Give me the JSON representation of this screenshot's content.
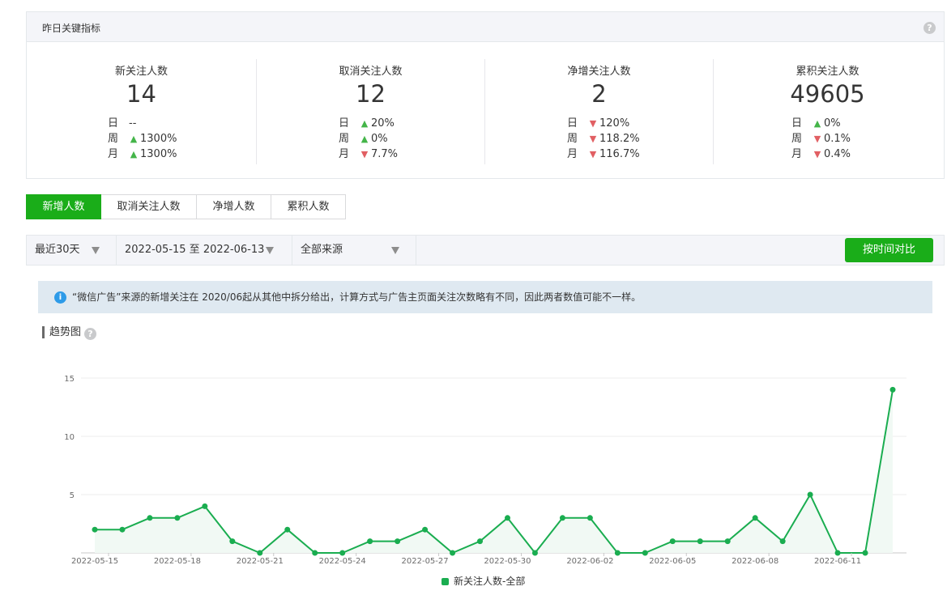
{
  "metrics_panel": {
    "title": "昨日关键指标",
    "help": "?",
    "cards": [
      {
        "label": "新关注人数",
        "value": "14",
        "rows": [
          {
            "key": "日",
            "dir": "none",
            "val": "--"
          },
          {
            "key": "周",
            "dir": "up",
            "val": "1300%"
          },
          {
            "key": "月",
            "dir": "up",
            "val": "1300%"
          }
        ]
      },
      {
        "label": "取消关注人数",
        "value": "12",
        "rows": [
          {
            "key": "日",
            "dir": "up",
            "val": "20%"
          },
          {
            "key": "周",
            "dir": "up",
            "val": "0%"
          },
          {
            "key": "月",
            "dir": "down",
            "val": "7.7%"
          }
        ]
      },
      {
        "label": "净增关注人数",
        "value": "2",
        "rows": [
          {
            "key": "日",
            "dir": "down",
            "val": "120%"
          },
          {
            "key": "周",
            "dir": "down",
            "val": "118.2%"
          },
          {
            "key": "月",
            "dir": "down",
            "val": "116.7%"
          }
        ]
      },
      {
        "label": "累积关注人数",
        "value": "49605",
        "rows": [
          {
            "key": "日",
            "dir": "up",
            "val": "0%"
          },
          {
            "key": "周",
            "dir": "down",
            "val": "0.1%"
          },
          {
            "key": "月",
            "dir": "down",
            "val": "0.4%"
          }
        ]
      }
    ]
  },
  "tabs": [
    {
      "label": "新增人数",
      "active": true
    },
    {
      "label": "取消关注人数",
      "active": false
    },
    {
      "label": "净增人数",
      "active": false
    },
    {
      "label": "累积人数",
      "active": false
    }
  ],
  "filters": {
    "period": "最近30天",
    "date_range": "2022-05-15 至 2022-06-13",
    "source": "全部来源",
    "compare_button": "按时间对比"
  },
  "notice": {
    "icon": "i",
    "text": "“微信广告”来源的新增关注在 2020/06起从其他中拆分给出，计算方式与广告主页面关注次数略有不同，因此两者数值可能不一样。"
  },
  "trend": {
    "title": "趋势图",
    "help": "?"
  },
  "colors": {
    "accent": "#1aad19",
    "line": "#1aad50",
    "up": "#44b549",
    "down": "#e15f63"
  },
  "chart_data": {
    "type": "line",
    "x": [
      "2022-05-15",
      "2022-05-16",
      "2022-05-17",
      "2022-05-18",
      "2022-05-19",
      "2022-05-20",
      "2022-05-21",
      "2022-05-22",
      "2022-05-23",
      "2022-05-24",
      "2022-05-25",
      "2022-05-26",
      "2022-05-27",
      "2022-05-28",
      "2022-05-29",
      "2022-05-30",
      "2022-05-31",
      "2022-06-01",
      "2022-06-02",
      "2022-06-03",
      "2022-06-04",
      "2022-06-05",
      "2022-06-06",
      "2022-06-07",
      "2022-06-08",
      "2022-06-09",
      "2022-06-10",
      "2022-06-11",
      "2022-06-12",
      "2022-06-13"
    ],
    "x_tick_labels": [
      "2022-05-15",
      "2022-05-18",
      "2022-05-21",
      "2022-05-24",
      "2022-05-27",
      "2022-05-30",
      "2022-06-02",
      "2022-06-05",
      "2022-06-08",
      "2022-06-11"
    ],
    "series": [
      {
        "name": "新关注人数-全部",
        "values": [
          2,
          2,
          3,
          3,
          4,
          1,
          0,
          2,
          0,
          0,
          1,
          1,
          2,
          0,
          1,
          3,
          0,
          3,
          3,
          0,
          0,
          1,
          1,
          1,
          3,
          1,
          5,
          0,
          0,
          14
        ]
      }
    ],
    "y_ticks": [
      5,
      10,
      15
    ],
    "ylim": [
      0,
      15
    ],
    "grid": true,
    "legend_position": "bottom-center"
  }
}
